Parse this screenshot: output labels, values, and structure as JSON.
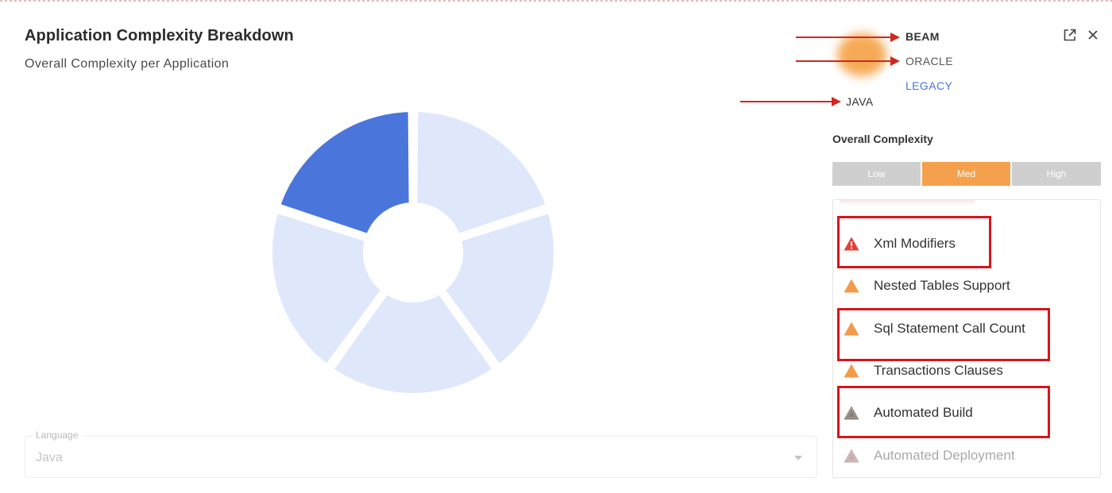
{
  "header": {
    "title": "Application Complexity Breakdown",
    "subtitle": "Overall Complexity per Application"
  },
  "window_controls": {
    "popout_icon": "external-link-icon",
    "close_icon": "close-icon"
  },
  "legend": [
    {
      "label": "BEAM",
      "color": "#222222"
    },
    {
      "label": "ORACLE",
      "color": "#555555"
    },
    {
      "label": "LEGACY",
      "color": "#4a74d6"
    },
    {
      "label": "JAVA",
      "color": "#333333"
    }
  ],
  "colors": {
    "accent_blue": "#4a76dc",
    "segment_light": "#dfe7fb",
    "med": "#f5a04d",
    "annotation_red": "#d9141b"
  },
  "donut": {
    "segments": 5,
    "highlighted_segment": 1
  },
  "language_field": {
    "label": "Language",
    "value": "Java"
  },
  "complexity": {
    "title": "Overall Complexity",
    "levels": [
      "Low",
      "Med",
      "High"
    ],
    "selected": "Med"
  },
  "items": [
    {
      "label": "Xml Modifiers",
      "icon": "warning-icon",
      "color": "#e0413a"
    },
    {
      "label": "Nested Tables Support",
      "icon": "warning-icon",
      "color": "#f39a4a"
    },
    {
      "label": "Sql Statement Call Count",
      "icon": "warning-icon",
      "color": "#f39a4a"
    },
    {
      "label": "Transactions Clauses",
      "icon": "warning-icon",
      "color": "#f39a4a"
    },
    {
      "label": "Automated Build",
      "icon": "warning-icon",
      "color": "#8a8078"
    },
    {
      "label": "Automated Deployment",
      "icon": "warning-icon",
      "color": "#c9aaaa"
    }
  ]
}
